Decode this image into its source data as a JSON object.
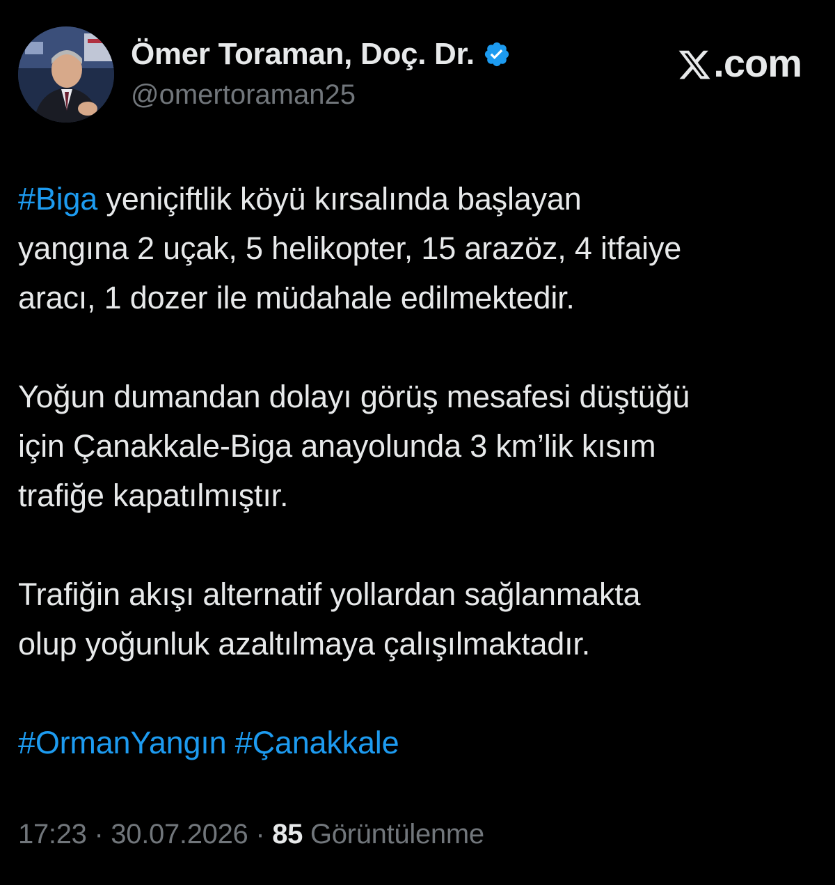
{
  "author": {
    "display_name": "Ömer Toraman, Doç. Dr.",
    "handle": "@omertoraman25",
    "verified": true,
    "verified_icon": "verified-badge-icon"
  },
  "brand": {
    "logo_icon": "x-logo-icon",
    "label": ".com"
  },
  "tweet": {
    "paragraphs": [
      {
        "segments": [
          {
            "text": "#Biga",
            "hashtag": true
          },
          {
            "text": " yeniçiftlik köyü kırsalında başlayan",
            "hashtag": false
          }
        ],
        "lines_after": [
          "yangına 2 uçak, 5 helikopter, 15 arazöz, 4 itfaiye",
          "aracı, 1 dozer ile müdahale edilmektedir."
        ]
      }
    ],
    "para2_lines": [
      "Yoğun dumandan dolayı görüş mesafesi düştüğü",
      "için Çanakkale-Biga anayolunda 3 km’lik kısım",
      "trafiğe kapatılmıştır."
    ],
    "para3_lines": [
      "Trafiğin akışı alternatif yollardan sağlanmakta",
      "olup yoğunluk azaltılmaya çalışılmaktadır."
    ],
    "hashtags": [
      "#OrmanYangın",
      "#Çanakkale"
    ]
  },
  "meta": {
    "time": "17:23",
    "separator": "·",
    "date": "30.07.2026",
    "views_count": "85",
    "views_label": "Görüntülenme"
  },
  "colors": {
    "background": "#000000",
    "text": "#e7e9ea",
    "secondary": "#71767b",
    "accent": "#1d9bf0"
  }
}
